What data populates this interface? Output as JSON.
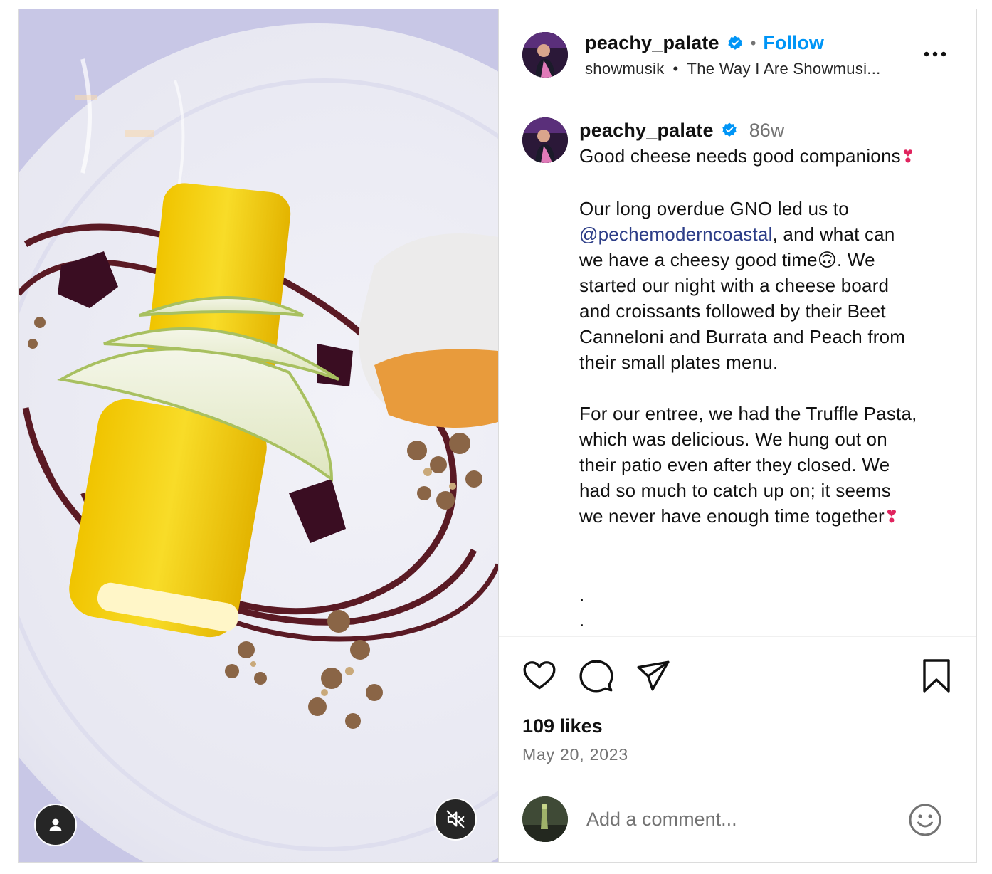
{
  "header": {
    "username": "peachy_palate",
    "separator": "•",
    "follow_label": "Follow",
    "audio_artist": "showmusik",
    "audio_bullet": "•",
    "audio_title": "The Way I Are Showmusi..."
  },
  "caption": {
    "username": "peachy_palate",
    "time_ago": "86w",
    "line_title": "Good cheese needs good companions",
    "p1_a": "Our long overdue GNO led us to\n",
    "mention": "@pechemoderncoastal",
    "p1_b": ", and what can\nwe have a cheesy good time",
    "p1_c": ". We\nstarted our night with a cheese board\nand croissants followed by their Beet\nCanneloni and Burrata and Peach from\ntheir small plates menu.",
    "p2": "For our entree, we had the Truffle Pasta,\nwhich was delicious. We hung out on\ntheir patio even after they closed. We\nhad so much to catch up on; it seems\nwe never have enough time together",
    "dots": ".\n.\n."
  },
  "emoji": {
    "heart": "❣",
    "upside_down": "🙃"
  },
  "stats": {
    "likes": "109 likes",
    "date": "May 20, 2023"
  },
  "comment": {
    "placeholder": "Add a comment..."
  },
  "icons": {
    "header": [
      "verified-badge-icon",
      "more-options-icon"
    ],
    "actions": [
      "like-heart-icon",
      "comment-icon",
      "share-icon",
      "save-bookmark-icon"
    ],
    "media": [
      "tagged-user-icon",
      "muted-speaker-icon"
    ],
    "comment": [
      "emoji-smiley-icon"
    ]
  },
  "colors": {
    "accent": "#0095f6",
    "mention": "#2c3d87",
    "muted_text": "#737373",
    "border": "#dbdbdb"
  }
}
